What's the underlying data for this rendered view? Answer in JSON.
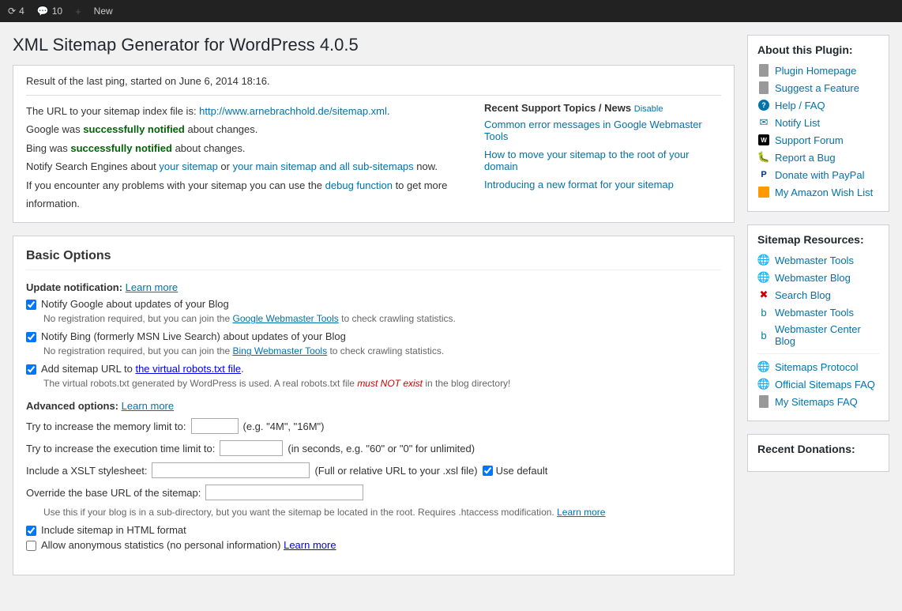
{
  "adminbar": {
    "items": [
      {
        "icon": "4",
        "label": "4",
        "type": "updates"
      },
      {
        "icon": "10",
        "label": "10",
        "type": "comments"
      },
      {
        "label": "New",
        "type": "new"
      }
    ]
  },
  "page": {
    "title": "XML Sitemap Generator for WordPress 4.0.5"
  },
  "result_box": {
    "header": "Result of the last ping, started on June 6, 2014 18:16.",
    "sitemap_url_prefix": "The URL to your sitemap index file is: ",
    "sitemap_url": "http://www.arnebrachhold.de/sitemap.xml",
    "sitemap_url_suffix": ".",
    "google_line": "Google was ",
    "google_success": "successfully notified",
    "google_suffix": " about changes.",
    "bing_line": "Bing was ",
    "bing_success": "successfully notified",
    "bing_suffix": " about changes.",
    "notify_line_prefix": "Notify Search Engines about ",
    "notify_link1": "your sitemap",
    "notify_link_sep": " or ",
    "notify_link2": "your main sitemap and all sub-sitemaps",
    "notify_line_suffix": " now.",
    "debug_prefix": "If you encounter any problems with your sitemap you can use the ",
    "debug_link": "debug function",
    "debug_suffix": " to get more information."
  },
  "support": {
    "header": "Recent Support Topics / News",
    "disable_link": "Disable",
    "topics": [
      "Common error messages in Google Webmaster Tools",
      "How to move your sitemap to the root of your domain",
      "Introducing a new format for your sitemap"
    ]
  },
  "options": {
    "section_title": "Basic Options",
    "update_notification_label": "Update notification:",
    "update_notification_link": "Learn more",
    "notify_google_label": "Notify Google about updates of your Blog",
    "notify_google_note_prefix": "No registration required, but you can join the ",
    "notify_google_link": "Google Webmaster Tools",
    "notify_google_note_suffix": " to check crawling statistics.",
    "notify_bing_label": "Notify Bing (formerly MSN Live Search) about updates of your Blog",
    "notify_bing_note_prefix": "No registration required, but you can join the ",
    "notify_bing_link": "Bing Webmaster Tools",
    "notify_bing_note_suffix": " to check crawling statistics.",
    "add_sitemap_label_prefix": "Add sitemap URL to ",
    "add_sitemap_link": "the virtual robots.txt file",
    "add_sitemap_label_suffix": ".",
    "virtual_robots_note": "The virtual robots.txt generated by WordPress is used. A real robots.txt file must NOT exist in the blog directory!",
    "virtual_not_exist": "must NOT exist",
    "advanced_label": "Advanced options:",
    "advanced_link": "Learn more",
    "memory_label": "Try to increase the memory limit to:",
    "memory_placeholder": "",
    "memory_example": "(e.g. \"4M\", \"16M\")",
    "execution_label": "Try to increase the execution time limit to:",
    "execution_placeholder": "",
    "execution_example": "(in seconds, e.g. \"60\" or \"0\" for unlimited)",
    "xslt_label": "Include a XSLT stylesheet:",
    "xslt_placeholder": "",
    "xslt_note": "(Full or relative URL to your .xsl file)",
    "use_default": "Use default",
    "base_url_label": "Override the base URL of the sitemap:",
    "base_url_placeholder": "",
    "base_url_note_prefix": "Use this if your blog is in a sub-directory, but you want the sitemap be located in the root. Requires .htaccess modification. ",
    "base_url_learn_link": "Learn more",
    "html_label": "Include sitemap in HTML format",
    "anon_label": "Allow anonymous statistics (no personal information) ",
    "anon_learn_link": "Learn more"
  },
  "sidebar": {
    "about_title": "About this Plugin:",
    "links": [
      {
        "label": "Plugin Homepage",
        "icon": "page"
      },
      {
        "label": "Suggest a Feature",
        "icon": "page"
      },
      {
        "label": "Help / FAQ",
        "icon": "question"
      },
      {
        "label": "Notify List",
        "icon": "email"
      },
      {
        "label": "Support Forum",
        "icon": "w"
      },
      {
        "label": "Report a Bug",
        "icon": "bug"
      },
      {
        "label": "Donate with PayPal",
        "icon": "paypal"
      },
      {
        "label": "My Amazon Wish List",
        "icon": "amazon"
      }
    ],
    "resources_title": "Sitemap Resources:",
    "resources": [
      {
        "label": "Webmaster Tools",
        "icon": "google"
      },
      {
        "label": "Webmaster Blog",
        "icon": "google"
      },
      {
        "label": "Search Blog",
        "icon": "bing"
      },
      {
        "label": "Webmaster Tools",
        "icon": "bing2"
      },
      {
        "label": "Webmaster Center Blog",
        "icon": "bing2"
      },
      {
        "label": "Sitemaps Protocol",
        "icon": "google"
      },
      {
        "label": "Official Sitemaps FAQ",
        "icon": "google"
      },
      {
        "label": "My Sitemaps FAQ",
        "icon": "doc"
      }
    ],
    "donations_title": "Recent Donations:"
  }
}
